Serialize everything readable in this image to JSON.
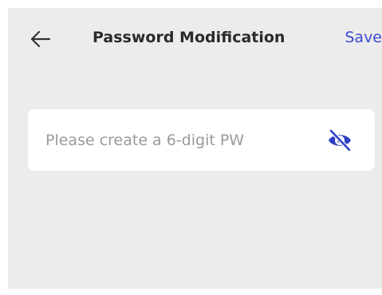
{
  "header": {
    "title": "Password Modification",
    "save_label": "Save",
    "back_icon": "arrow-left-icon"
  },
  "password_field": {
    "placeholder": "Please create a 6-digit PW",
    "value": "",
    "toggle_icon": "eye-off-icon"
  },
  "colors": {
    "background": "#ececec",
    "field_background": "#ffffff",
    "accent": "#3a4bd0",
    "title": "#2a2a2a",
    "placeholder": "#9a9a9a"
  }
}
